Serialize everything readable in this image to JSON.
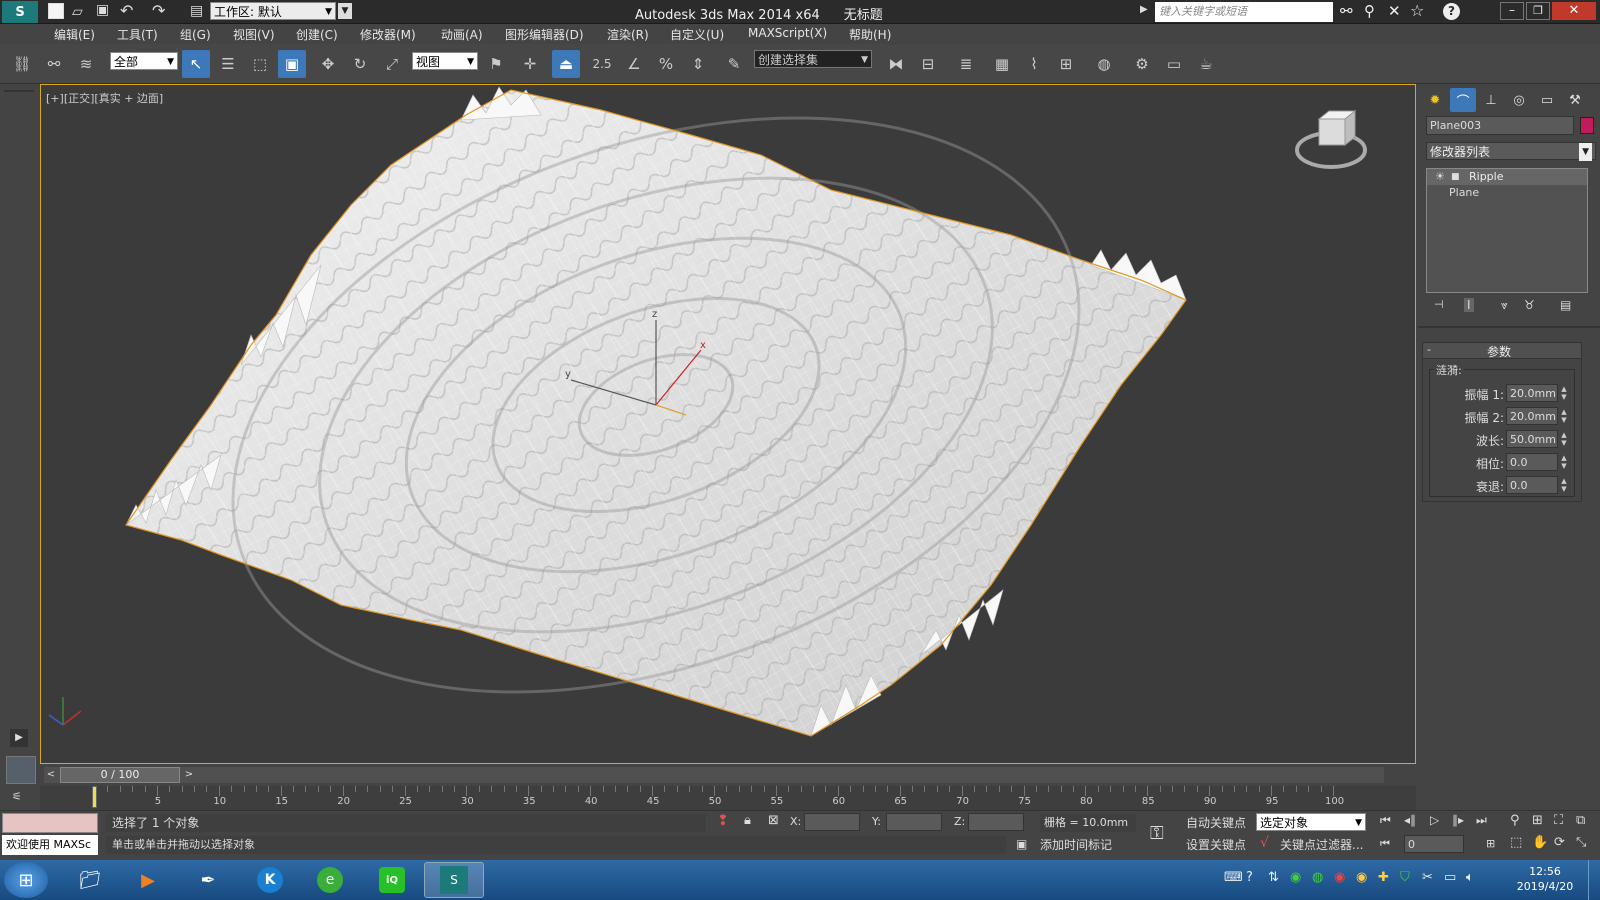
{
  "title_bar": {
    "workspace": "工作区: 默认",
    "app_title": "Autodesk 3ds Max  2014 x64",
    "doc_title": "无标题",
    "search_placeholder": "键入关键字或短语"
  },
  "menus": [
    "编辑(E)",
    "工具(T)",
    "组(G)",
    "视图(V)",
    "创建(C)",
    "修改器(M)",
    "动画(A)",
    "图形编辑器(D)",
    "渲染(R)",
    "自定义(U)",
    "MAXScript(X)",
    "帮助(H)"
  ],
  "toolbar": {
    "selection_filter": "全部",
    "ref_coord": "视图",
    "snap_label": "2.5",
    "named_selection": "创建选择集"
  },
  "viewport": {
    "label_plus": "[+]",
    "label_view": "[正交]",
    "label_shading": "[真实 + 边面]",
    "gizmo_x": "x",
    "gizmo_y": "y",
    "gizmo_z": "z"
  },
  "command_panel": {
    "object_name": "Plane003",
    "object_color": "#c21a5a",
    "modifier_list": "修改器列表",
    "stack": [
      "Ripple",
      "Plane"
    ],
    "rollout_title": "参数",
    "group_label": "涟漪:",
    "params": [
      {
        "label": "振幅 1:",
        "value": "20.0mm"
      },
      {
        "label": "振幅 2:",
        "value": "20.0mm"
      },
      {
        "label": "波长:",
        "value": "50.0mm"
      },
      {
        "label": "相位:",
        "value": "0.0"
      },
      {
        "label": "衰退:",
        "value": "0.0"
      }
    ]
  },
  "timeline": {
    "frame_counter": "0 / 100",
    "ticks": [
      "5",
      "10",
      "15",
      "20",
      "25",
      "30",
      "35",
      "40",
      "45",
      "50",
      "55",
      "60",
      "65",
      "70",
      "75",
      "80",
      "85",
      "90",
      "95",
      "100"
    ]
  },
  "status": {
    "maxscript_label": "欢迎使用 MAXSc",
    "selection_msg": "选择了 1 个对象",
    "prompt_msg": "单击或单击并拖动以选择对象",
    "x_label": "X:",
    "y_label": "Y:",
    "z_label": "Z:",
    "grid": "栅格 = 10.0mm",
    "add_time_tag": "添加时间标记",
    "auto_key": "自动关键点",
    "selected_object": "选定对象",
    "set_key": "设置关键点",
    "key_filters": "关键点过滤器...",
    "frame_value": "0"
  },
  "taskbar": {
    "time": "12:56",
    "date": "2019/4/20"
  },
  "colors": {
    "accent": "#3d78b8",
    "viewport_border": "#d8a81e",
    "selection_edge": "#e0961e"
  }
}
